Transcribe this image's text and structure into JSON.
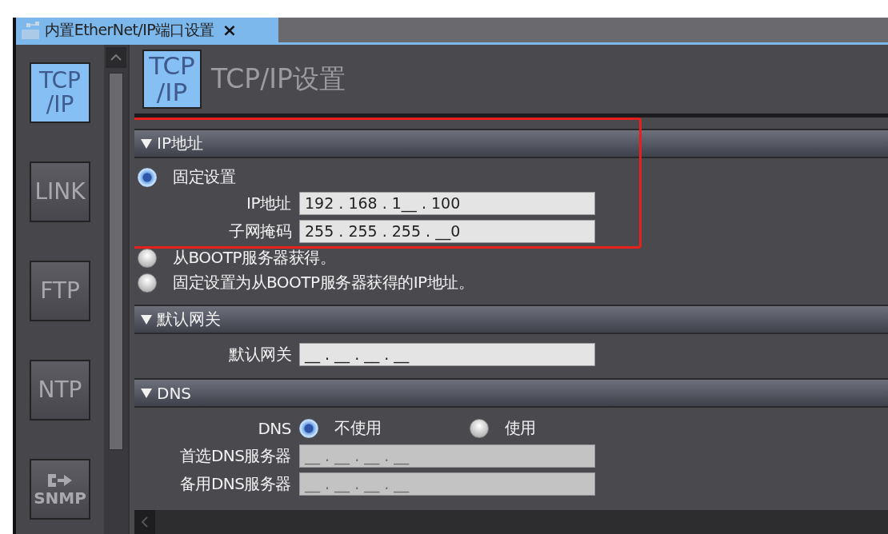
{
  "tab": {
    "title": "内置EtherNet/IP端口设置",
    "close": "×",
    "selected": true
  },
  "sidebar": {
    "items": [
      {
        "lines": [
          "TCP",
          "/IP"
        ],
        "kind": "text",
        "selected": true
      },
      {
        "lines": [
          "LINK"
        ],
        "kind": "text",
        "selected": false
      },
      {
        "lines": [
          "FTP"
        ],
        "kind": "text",
        "selected": false
      },
      {
        "lines": [
          "NTP"
        ],
        "kind": "text",
        "selected": false
      },
      {
        "lines": [
          "SNMP"
        ],
        "kind": "arrow",
        "selected": false
      }
    ]
  },
  "page": {
    "icon_lines": [
      "TCP",
      "/IP"
    ],
    "title": "TCP/IP设置"
  },
  "sections": [
    {
      "title": "IP地址",
      "expanded": true,
      "highlighted": true,
      "rows": [
        {
          "kind": "radio",
          "label": "固定设置",
          "selected": true
        },
        {
          "kind": "field",
          "label": "IP地址",
          "value": "192 . 168 . 1__ . 100",
          "disabled": false
        },
        {
          "kind": "field",
          "label": "子网掩码",
          "value": "255 . 255 . 255 . __0",
          "disabled": false
        },
        {
          "kind": "radio",
          "label": "从BOOTP服务器获得。",
          "selected": false
        },
        {
          "kind": "radio",
          "label": "固定设置为从BOOTP服务器获得的IP地址。",
          "selected": false
        }
      ]
    },
    {
      "title": "默认网关",
      "expanded": true,
      "highlighted": false,
      "rows": [
        {
          "kind": "field",
          "label": "默认网关",
          "value": "__ . __ . __ . __",
          "disabled": false
        }
      ]
    },
    {
      "title": "DNS",
      "expanded": true,
      "highlighted": false,
      "rows": [
        {
          "kind": "choice",
          "label": "DNS",
          "options": [
            {
              "label": "不使用",
              "selected": true
            },
            {
              "label": "使用",
              "selected": false
            }
          ]
        },
        {
          "kind": "field",
          "label": "首选DNS服务器",
          "value": "__ . __ . __ . __",
          "disabled": true
        },
        {
          "kind": "field",
          "label": "备用DNS服务器",
          "value": "__ . __ . __ . __",
          "disabled": true
        }
      ]
    }
  ]
}
